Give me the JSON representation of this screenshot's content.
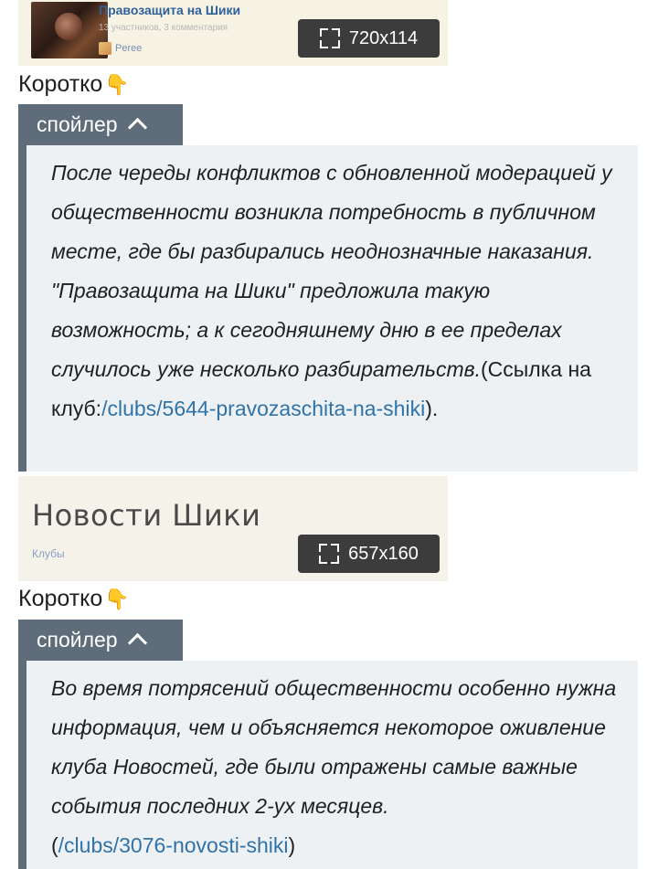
{
  "preview1": {
    "club_title": "Правозащита на Шики",
    "club_meta": "13 участников, 3 комментария",
    "club_user": "Peree",
    "dimensions": "720x114"
  },
  "block1": {
    "short_label": "Коротко",
    "pointer_icon": "👇",
    "spoiler_label": "спойлер",
    "text_italic": "После череды конфликтов с обновленной модерацией у общественности возникла потребность в публичном месте, где бы разбирались неоднозначные наказания. \"Правозащита на Шики\" предложила такую возможность; а к сегодняшнему дню в ее пределах случилось уже несколько разбирательств.",
    "text_prefix": "(Ссылка на клуб:",
    "link": "/clubs/5644-pravozaschita-na-shiki",
    "text_suffix": ")."
  },
  "preview2": {
    "title": "Новости Шики",
    "subtitle": "Клубы",
    "dimensions": "657x160"
  },
  "block2": {
    "short_label": "Коротко",
    "pointer_icon": "👇",
    "spoiler_label": "спойлер",
    "text_italic": "Во время потрясений общественности особенно нужна информация, чем и объясняется некоторое оживление клуба Новостей, где были отражены самые важные события последних 2-ух месяцев.",
    "text_prefix": "(",
    "link": "/clubs/3076-novosti-shiki",
    "text_suffix": ")"
  }
}
